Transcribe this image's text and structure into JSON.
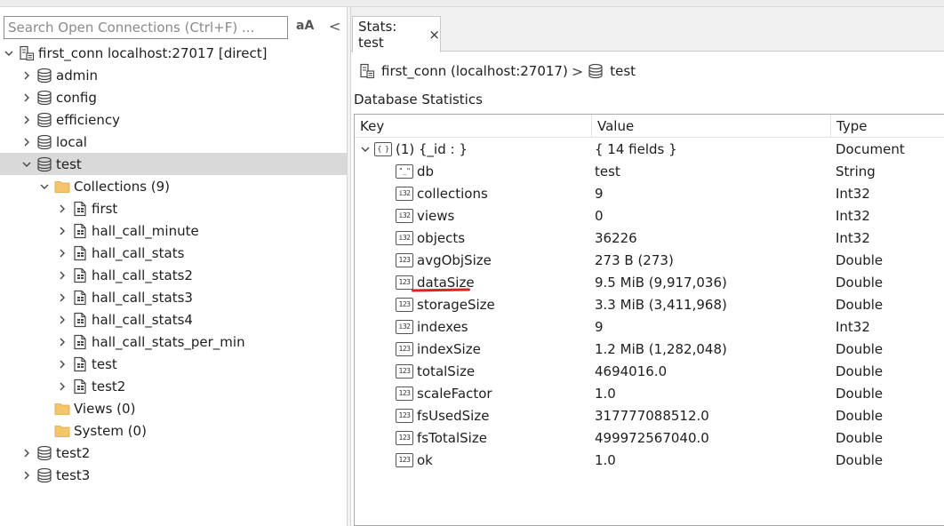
{
  "search": {
    "placeholder": "Search Open Connections (Ctrl+F) ..."
  },
  "toolbar": {
    "case_label": "aA",
    "collapse_label": "<"
  },
  "tree": {
    "connection": "first_conn localhost:27017 [direct]",
    "databases": [
      {
        "label": "admin"
      },
      {
        "label": "config"
      },
      {
        "label": "efficiency"
      },
      {
        "label": "local"
      },
      {
        "label": "test"
      },
      {
        "label": "test2"
      },
      {
        "label": "test3"
      }
    ],
    "collections_label": "Collections (9)",
    "collections": [
      "first",
      "hall_call_minute",
      "hall_call_stats",
      "hall_call_stats2",
      "hall_call_stats3",
      "hall_call_stats4",
      "hall_call_stats_per_min",
      "test",
      "test2"
    ],
    "views_label": "Views (0)",
    "system_label": "System (0)"
  },
  "tab": {
    "label": "Stats: test",
    "close": "×"
  },
  "breadcrumb": {
    "connection": "first_conn (localhost:27017)",
    "sep": ">",
    "database": "test"
  },
  "section_title": "Database Statistics",
  "table": {
    "headers": {
      "key": "Key",
      "value": "Value",
      "type": "Type"
    },
    "root": {
      "key": "(1) {_id : }",
      "value": "{ 14 fields }",
      "type": "Document"
    },
    "rows": [
      {
        "icon": "\"_\"",
        "key": "db",
        "value": "test",
        "type": "String"
      },
      {
        "icon": "i32",
        "key": "collections",
        "value": "9",
        "type": "Int32"
      },
      {
        "icon": "i32",
        "key": "views",
        "value": "0",
        "type": "Int32"
      },
      {
        "icon": "i32",
        "key": "objects",
        "value": "36226",
        "type": "Int32"
      },
      {
        "icon": "123",
        "key": "avgObjSize",
        "value": "273 B  (273)",
        "type": "Double"
      },
      {
        "icon": "123",
        "key": "dataSize",
        "value": "9.5 MiB  (9,917,036)",
        "type": "Double"
      },
      {
        "icon": "123",
        "key": "storageSize",
        "value": "3.3 MiB  (3,411,968)",
        "type": "Double"
      },
      {
        "icon": "i32",
        "key": "indexes",
        "value": "9",
        "type": "Int32"
      },
      {
        "icon": "123",
        "key": "indexSize",
        "value": "1.2 MiB  (1,282,048)",
        "type": "Double"
      },
      {
        "icon": "123",
        "key": "totalSize",
        "value": "4694016.0",
        "type": "Double"
      },
      {
        "icon": "123",
        "key": "scaleFactor",
        "value": "1.0",
        "type": "Double"
      },
      {
        "icon": "123",
        "key": "fsUsedSize",
        "value": "317777088512.0",
        "type": "Double"
      },
      {
        "icon": "123",
        "key": "fsTotalSize",
        "value": "499972567040.0",
        "type": "Double"
      },
      {
        "icon": "123",
        "key": "ok",
        "value": "1.0",
        "type": "Double"
      }
    ]
  },
  "colors": {
    "selected_row": "#d9d9d9",
    "folder": "#f5c56b",
    "highlight_underline": "#d9251d"
  }
}
